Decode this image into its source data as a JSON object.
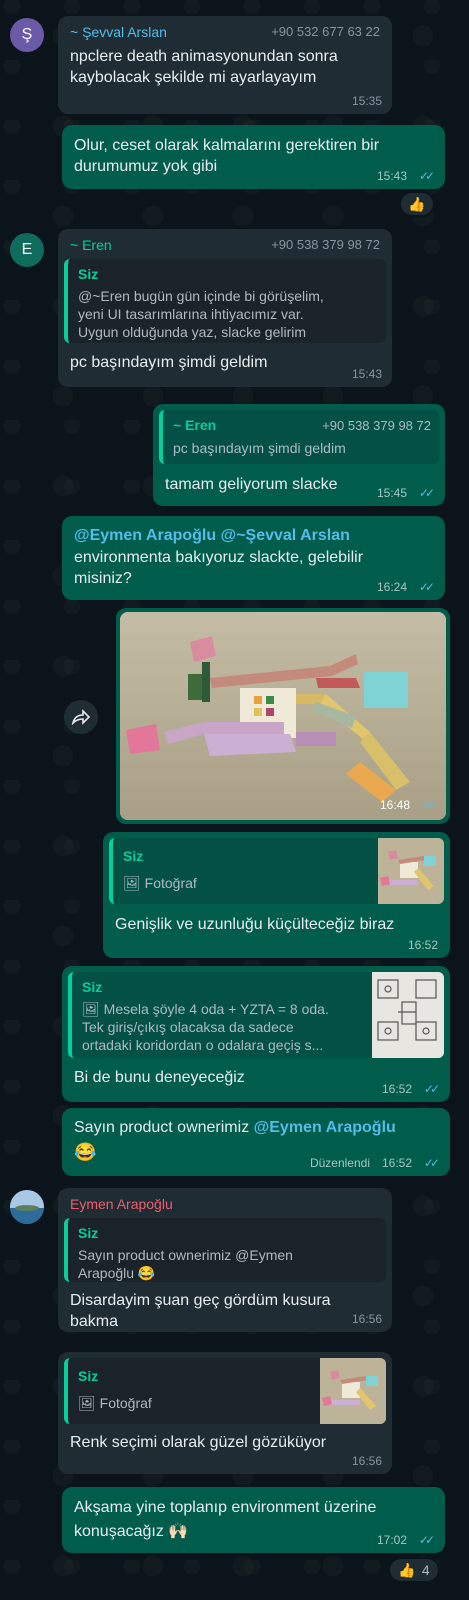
{
  "messages": {
    "m1": {
      "avatar": "Ş",
      "sender": "~ Şevval Arslan",
      "phone": "+90 532 677 63 22",
      "line1": "npclere death animasyonundan sonra",
      "line2": "kaybolacak şekilde mi ayarlayayım",
      "time": "15:35"
    },
    "m2": {
      "line1": "Olur, ceset olarak kalmalarını gerektiren bir",
      "line2": "durumumuz yok gibi",
      "time": "15:43",
      "reaction": "👍"
    },
    "m3": {
      "avatar": "E",
      "sender": "~ Eren",
      "phone": "+90 538 379 98 72",
      "quote_name": "Siz",
      "quote1": "@~Eren bugün gün içinde bi görüşelim,",
      "quote2": "yeni UI tasarımlarına ihtiyacımız var.",
      "quote3": "Uygun olduğunda yaz, slacke gelirim",
      "text": "pc başındayım şimdi geldim",
      "time": "15:43"
    },
    "m4": {
      "quote_name": "~ Eren",
      "quote_phone": "+90 538 379 98 72",
      "quote1": "pc başındayım şimdi geldim",
      "text": "tamam geliyorum slacke",
      "time": "15:45"
    },
    "m5": {
      "mention": "@Eymen Arapoğlu @~Şevval Arslan",
      "line1": "environmenta bakıyoruz slackte, gelebilir",
      "line2": "misiniz?",
      "time": "16:24"
    },
    "m6": {
      "time": "16:48",
      "forward_icon": "forward-icon"
    },
    "m7": {
      "quote_name": "Siz",
      "quote1": "Fotoğraf",
      "text": "Genişlik ve uzunluğu küçülteceğiz biraz",
      "time": "16:52"
    },
    "m8": {
      "quote_name": "Siz",
      "quote1": "Mesela şöyle 4 oda + YZTA = 8 oda.",
      "quote2": "Tek giriş/çıkış olacaksa da sadece",
      "quote3": "ortadaki koridordan o odalara geçiş s...",
      "text": "Bi de bunu deneyeceğiz",
      "time": "16:52"
    },
    "m9": {
      "line1": "Sayın product ownerimiz ",
      "mention": "@Eymen Arapoğlu",
      "emoji": "😂",
      "edited": "Düzenlendi",
      "time": "16:52"
    },
    "m10": {
      "sender": "Eymen Arapoğlu",
      "quote_name": "Siz",
      "quote1": "Sayın product ownerimiz @Eymen",
      "quote2": "Arapoğlu 😂",
      "line1": "Disardayim şuan geç gördüm kusura",
      "line2": "bakma",
      "time": "16:56"
    },
    "m11": {
      "quote_name": "Siz",
      "quote1": "Fotoğraf",
      "text": "Renk seçimi olarak güzel gözüküyor",
      "time": "16:56"
    },
    "m12": {
      "line1": "Akşama yine toplanıp environment üzerine",
      "line2": "konuşacağız 🙌🏻",
      "time": "17:02",
      "reaction": "👍",
      "reaction_count": "4"
    }
  },
  "colors": {
    "incoming": "#1f2c34",
    "outgoing": "#005c4b",
    "read_ticks": "#53bdeb",
    "sender_sevval": "#53bdeb",
    "sender_eren": "#06cf9c",
    "sender_eymen": "#f15c6d"
  },
  "icons": {
    "photo_placeholder": "image-icon",
    "read_receipt": "double-check-icon"
  }
}
